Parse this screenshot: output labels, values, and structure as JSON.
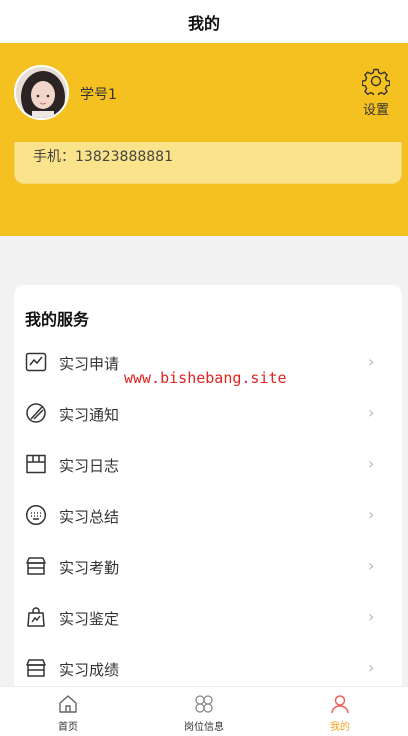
{
  "header": {
    "title": "我的"
  },
  "profile": {
    "username": "学号1",
    "settings_label": "设置",
    "phone": "手机：13823888881"
  },
  "watermark": "www.bishebang.site",
  "services": {
    "heading": "我的服务",
    "items": [
      {
        "label": "实习申请",
        "icon": "chart-icon"
      },
      {
        "label": "实习通知",
        "icon": "brush-icon"
      },
      {
        "label": "实习日志",
        "icon": "box-icon"
      },
      {
        "label": "实习总结",
        "icon": "keyboard-icon"
      },
      {
        "label": "实习考勤",
        "icon": "store-icon"
      },
      {
        "label": "实习鉴定",
        "icon": "bag-icon"
      },
      {
        "label": "实习成绩",
        "icon": "store-icon"
      }
    ]
  },
  "tabbar": {
    "items": [
      {
        "label": "首页",
        "icon": "home-icon"
      },
      {
        "label": "岗位信息",
        "icon": "grid-icon"
      },
      {
        "label": "我的",
        "icon": "user-icon"
      }
    ],
    "active": "我的"
  },
  "colors": {
    "accent": "#f5c120",
    "tab_active": "#f5a623"
  }
}
